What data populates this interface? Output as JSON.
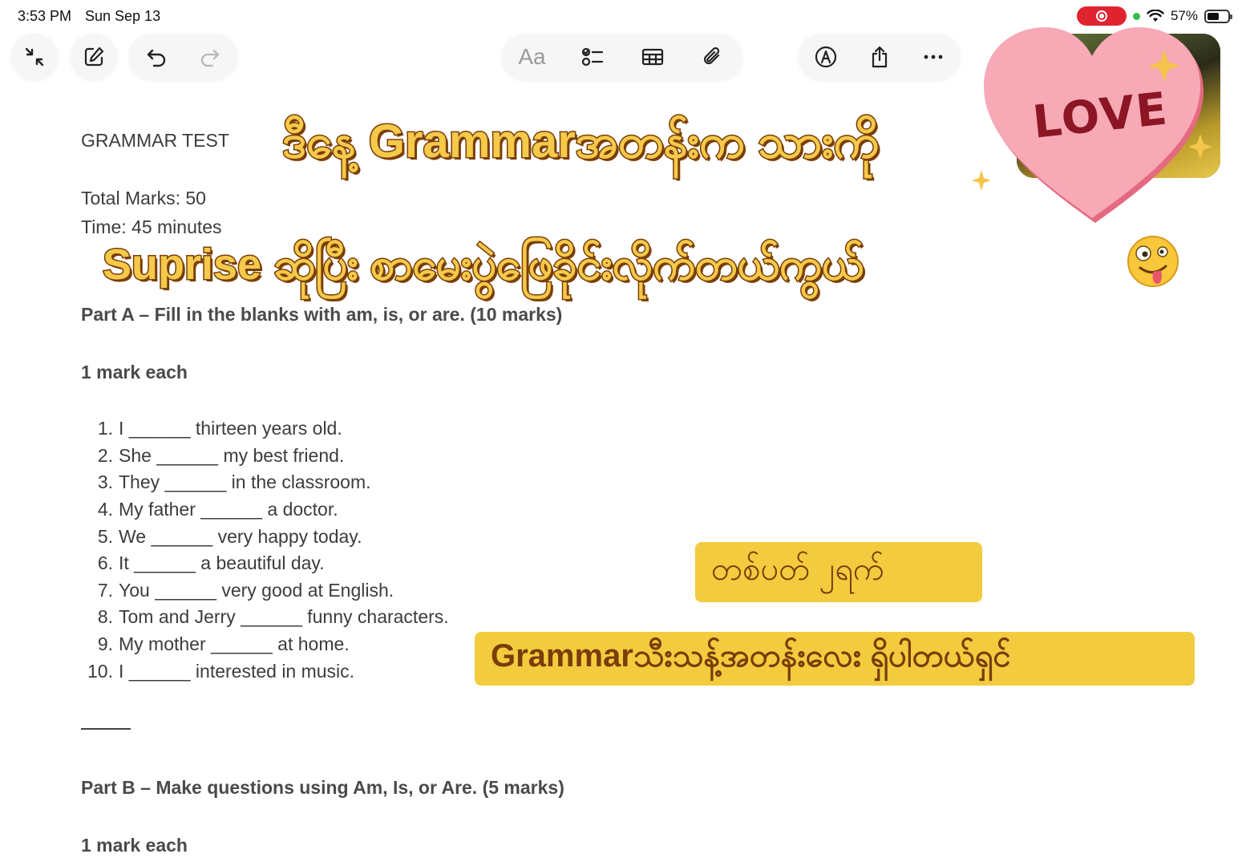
{
  "status_bar": {
    "time": "3:53 PM",
    "date": "Sun Sep 13",
    "battery_text": "57%",
    "battery_level": 0.57
  },
  "toolbar": {
    "format_label": "Aa",
    "icons": [
      "collapse-icon",
      "compose-icon",
      "undo-icon",
      "redo-icon",
      "checklist-icon",
      "table-icon",
      "attachment-icon",
      "markup-icon",
      "share-icon",
      "more-icon"
    ]
  },
  "document": {
    "title": "GRAMMAR TEST",
    "total_marks": "Total Marks: 50",
    "time": "Time: 45 minutes",
    "part_a_heading": "Part A – Fill in the blanks with am, is, or are. (10 marks)",
    "part_a_marks": "1 mark each",
    "questions": [
      {
        "num": "1.",
        "text": "I ______ thirteen years old."
      },
      {
        "num": "2.",
        "text": "She ______ my best friend."
      },
      {
        "num": "3.",
        "text": "They ______ in the classroom."
      },
      {
        "num": "4.",
        "text": "My father ______ a doctor."
      },
      {
        "num": "5.",
        "text": "We ______ very happy today."
      },
      {
        "num": "6.",
        "text": "It ______ a beautiful day."
      },
      {
        "num": "7.",
        "text": "You ______ very good at English."
      },
      {
        "num": "8.",
        "text": "Tom and Jerry ______ funny characters."
      },
      {
        "num": "9.",
        "text": "My mother ______ at home."
      },
      {
        "num": "10.",
        "text": "I ______ interested in music."
      }
    ],
    "part_b_heading": "Part B – Make questions using Am, Is, or Are. (5 marks)",
    "part_b_marks": "1 mark each"
  },
  "overlays": {
    "heading_line_1": "ဒီနေ့ Grammarအတန်းက သားကို",
    "heading_line_2": "Suprise ဆိုပြီး စာမေးပွဲဖြေခိုင်းလိုက်တယ်ကွယ်",
    "badge_1": "တစ်ပတ် ၂ရက်",
    "badge_2": "Grammarသီးသန့်အတန်းလေး ရှိပါတယ်ရှင်",
    "sticker_text": "LOVE"
  },
  "colors": {
    "overlay_fill": "#f5c94a",
    "overlay_stroke": "#7a3e07",
    "badge_bg": "#f2cc3e",
    "badge_text": "#7a3c08",
    "heart": "#f7a9b6",
    "love_text": "#8c1623",
    "recording": "#e0242f"
  }
}
